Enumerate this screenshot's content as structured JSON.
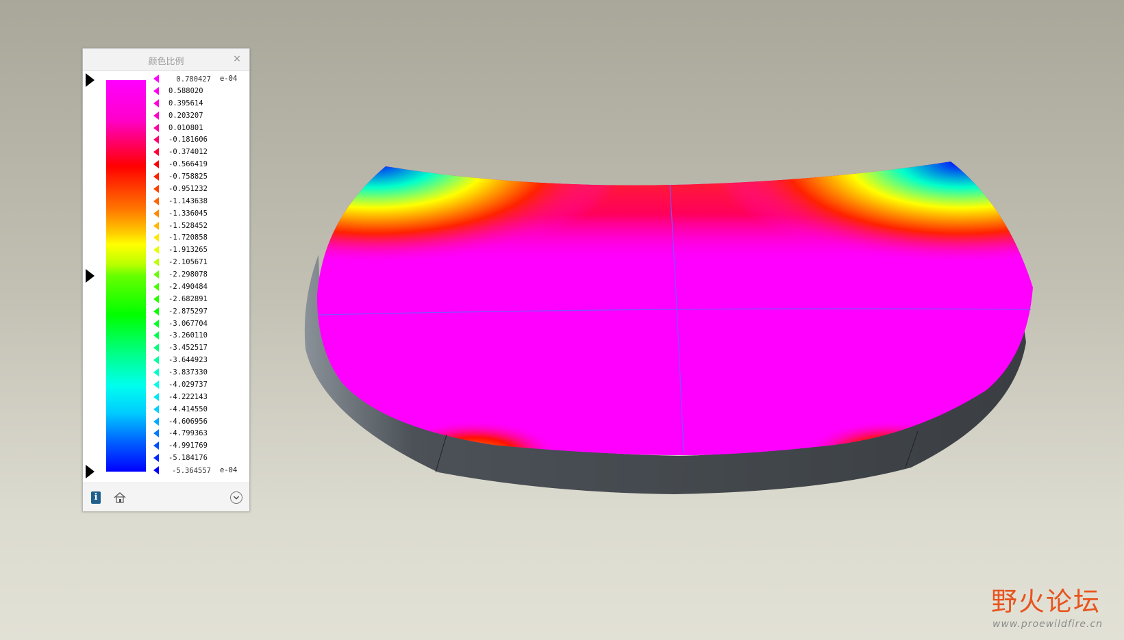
{
  "panel": {
    "title": "颜色比例",
    "close_icon": "×",
    "max_value": "0.780427",
    "min_value": "-5.364557",
    "exponent_top": "e-04",
    "exponent_bottom": "e-04",
    "scale_values": [
      "0.588020",
      "0.395614",
      "0.203207",
      "0.010801",
      "-0.181606",
      "-0.374012",
      "-0.566419",
      "-0.758825",
      "-0.951232",
      "-1.143638",
      "-1.336045",
      "-1.528452",
      "-1.720858",
      "-1.913265",
      "-2.105671",
      "-2.298078",
      "-2.490484",
      "-2.682891",
      "-2.875297",
      "-3.067704",
      "-3.260110",
      "-3.452517",
      "-3.644923",
      "-3.837330",
      "-4.029737",
      "-4.222143",
      "-4.414550",
      "-4.606956",
      "-4.799363",
      "-4.991769",
      "-5.184176"
    ],
    "footer": {
      "info_label": "i"
    },
    "colors": {
      "max": "#ff00ff",
      "mid": "#00ff00",
      "min": "#0000ff"
    }
  },
  "watermark": {
    "logo_text": "野火论坛",
    "url": "www.proewildfire.cn"
  }
}
